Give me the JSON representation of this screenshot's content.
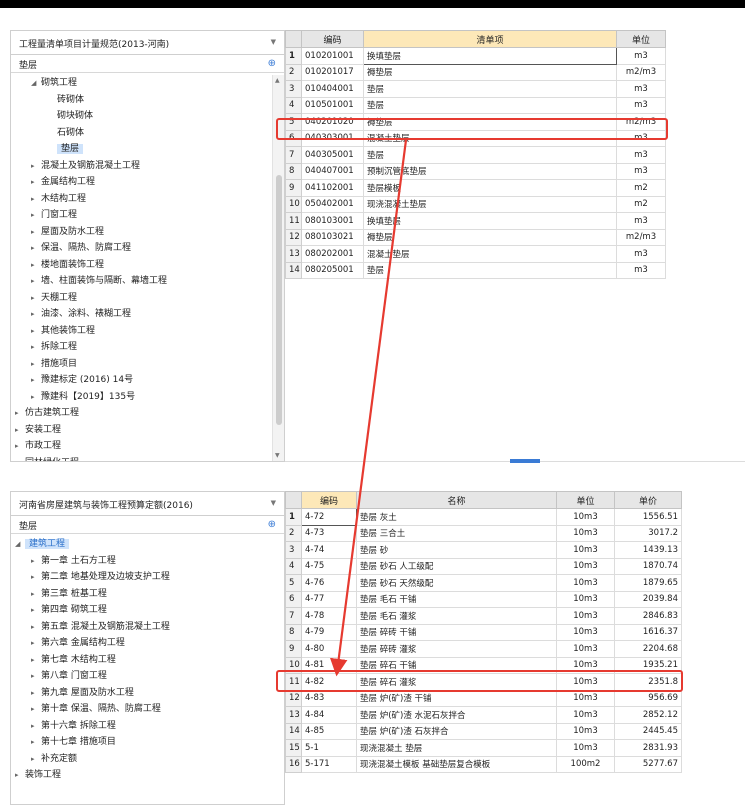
{
  "top_panel": {
    "combo_label": "工程量清单项目计量规范(2013-河南)",
    "filter_text": "垫层",
    "tree": [
      {
        "label": "砌筑工程",
        "level": 2,
        "toggle": "▲"
      },
      {
        "label": "砖砌体",
        "level": 4,
        "toggle": ""
      },
      {
        "label": "砌块砌体",
        "level": 4,
        "toggle": ""
      },
      {
        "label": "石砌体",
        "level": 4,
        "toggle": ""
      },
      {
        "label": "垫层",
        "level": 4,
        "toggle": "",
        "selected": true
      },
      {
        "label": "混凝土及钢筋混凝土工程",
        "level": 2,
        "toggle": "▸"
      },
      {
        "label": "金属结构工程",
        "level": 2,
        "toggle": "▸"
      },
      {
        "label": "木结构工程",
        "level": 2,
        "toggle": "▸"
      },
      {
        "label": "门窗工程",
        "level": 2,
        "toggle": "▸"
      },
      {
        "label": "屋面及防水工程",
        "level": 2,
        "toggle": "▸"
      },
      {
        "label": "保温、隔热、防腐工程",
        "level": 2,
        "toggle": "▸"
      },
      {
        "label": "楼地面装饰工程",
        "level": 2,
        "toggle": "▸"
      },
      {
        "label": "墙、柱面装饰与隔断、幕墙工程",
        "level": 2,
        "toggle": "▸"
      },
      {
        "label": "天棚工程",
        "level": 2,
        "toggle": "▸"
      },
      {
        "label": "油漆、涂料、裱糊工程",
        "level": 2,
        "toggle": "▸"
      },
      {
        "label": "其他装饰工程",
        "level": 2,
        "toggle": "▸"
      },
      {
        "label": "拆除工程",
        "level": 2,
        "toggle": "▸"
      },
      {
        "label": "措施项目",
        "level": 2,
        "toggle": "▸"
      },
      {
        "label": "豫建标定 (2016) 14号",
        "level": 2,
        "toggle": "▸"
      },
      {
        "label": "豫建科【2019】135号",
        "level": 2,
        "toggle": "▸"
      },
      {
        "label": "仿古建筑工程",
        "level": 0,
        "toggle": "▸"
      },
      {
        "label": "安装工程",
        "level": 0,
        "toggle": "▸"
      },
      {
        "label": "市政工程",
        "level": 0,
        "toggle": "▸"
      },
      {
        "label": "园林绿化工程",
        "level": 0,
        "toggle": "▸"
      }
    ],
    "grid": {
      "headers": [
        "",
        "编码",
        "清单项",
        "单位"
      ],
      "rows": [
        {
          "n": "1",
          "code": "010201001",
          "name": "换填垫层",
          "unit": "m3"
        },
        {
          "n": "2",
          "code": "010201017",
          "name": "褥垫层",
          "unit": "m2/m3"
        },
        {
          "n": "3",
          "code": "010404001",
          "name": "垫层",
          "unit": "m3"
        },
        {
          "n": "4",
          "code": "010501001",
          "name": "垫层",
          "unit": "m3"
        },
        {
          "n": "5",
          "code": "040201020",
          "name": "褥垫层",
          "unit": "m2/m3"
        },
        {
          "n": "6",
          "code": "040303001",
          "name": "混凝土垫层",
          "unit": "m3"
        },
        {
          "n": "7",
          "code": "040305001",
          "name": "垫层",
          "unit": "m3"
        },
        {
          "n": "8",
          "code": "040407001",
          "name": "预制沉管底垫层",
          "unit": "m3"
        },
        {
          "n": "9",
          "code": "041102001",
          "name": "垫层模板",
          "unit": "m2"
        },
        {
          "n": "10",
          "code": "050402001",
          "name": "现浇混凝土垫层",
          "unit": "m2"
        },
        {
          "n": "11",
          "code": "080103001",
          "name": "换填垫层",
          "unit": "m3"
        },
        {
          "n": "12",
          "code": "080103021",
          "name": "褥垫层",
          "unit": "m2/m3"
        },
        {
          "n": "13",
          "code": "080202001",
          "name": "混凝土垫层",
          "unit": "m3"
        },
        {
          "n": "14",
          "code": "080205001",
          "name": "垫层",
          "unit": "m3"
        }
      ]
    }
  },
  "bottom_panel": {
    "combo_label": "河南省房屋建筑与装饰工程预算定额(2016)",
    "filter_text": "垫层",
    "tree": [
      {
        "label": "建筑工程",
        "level": 0,
        "toggle": "▲",
        "blue": true,
        "selected": true
      },
      {
        "label": "第一章 土石方工程",
        "level": 2,
        "toggle": "▸"
      },
      {
        "label": "第二章 地基处理及边坡支护工程",
        "level": 2,
        "toggle": "▸"
      },
      {
        "label": "第三章 桩基工程",
        "level": 2,
        "toggle": "▸"
      },
      {
        "label": "第四章 砌筑工程",
        "level": 2,
        "toggle": "▸"
      },
      {
        "label": "第五章 混凝土及钢筋混凝土工程",
        "level": 2,
        "toggle": "▸"
      },
      {
        "label": "第六章 金属结构工程",
        "level": 2,
        "toggle": "▸"
      },
      {
        "label": "第七章 木结构工程",
        "level": 2,
        "toggle": "▸"
      },
      {
        "label": "第八章 门窗工程",
        "level": 2,
        "toggle": "▸"
      },
      {
        "label": "第九章 屋面及防水工程",
        "level": 2,
        "toggle": "▸"
      },
      {
        "label": "第十章 保温、隔热、防腐工程",
        "level": 2,
        "toggle": "▸"
      },
      {
        "label": "第十六章 拆除工程",
        "level": 2,
        "toggle": "▸"
      },
      {
        "label": "第十七章 措施项目",
        "level": 2,
        "toggle": "▸"
      },
      {
        "label": "补充定额",
        "level": 2,
        "toggle": "▸"
      },
      {
        "label": "装饰工程",
        "level": 0,
        "toggle": "▸"
      }
    ],
    "grid": {
      "headers": [
        "",
        "编码",
        "名称",
        "单位",
        "单价"
      ],
      "rows": [
        {
          "n": "1",
          "code": "4-72",
          "name": "垫层 灰土",
          "unit": "10m3",
          "price": "1556.51"
        },
        {
          "n": "2",
          "code": "4-73",
          "name": "垫层 三合土",
          "unit": "10m3",
          "price": "3017.2"
        },
        {
          "n": "3",
          "code": "4-74",
          "name": "垫层 砂",
          "unit": "10m3",
          "price": "1439.13"
        },
        {
          "n": "4",
          "code": "4-75",
          "name": "垫层 砂石 人工级配",
          "unit": "10m3",
          "price": "1870.74"
        },
        {
          "n": "5",
          "code": "4-76",
          "name": "垫层 砂石 天然级配",
          "unit": "10m3",
          "price": "1879.65"
        },
        {
          "n": "6",
          "code": "4-77",
          "name": "垫层 毛石 干铺",
          "unit": "10m3",
          "price": "2039.84"
        },
        {
          "n": "7",
          "code": "4-78",
          "name": "垫层 毛石 灌浆",
          "unit": "10m3",
          "price": "2846.83"
        },
        {
          "n": "8",
          "code": "4-79",
          "name": "垫层 碎砖 干铺",
          "unit": "10m3",
          "price": "1616.37"
        },
        {
          "n": "9",
          "code": "4-80",
          "name": "垫层 碎砖 灌浆",
          "unit": "10m3",
          "price": "2204.68"
        },
        {
          "n": "10",
          "code": "4-81",
          "name": "垫层 碎石 干铺",
          "unit": "10m3",
          "price": "1935.21"
        },
        {
          "n": "11",
          "code": "4-82",
          "name": "垫层 碎石 灌浆",
          "unit": "10m3",
          "price": "2351.8"
        },
        {
          "n": "12",
          "code": "4-83",
          "name": "垫层 炉(矿)渣 干铺",
          "unit": "10m3",
          "price": "956.69"
        },
        {
          "n": "13",
          "code": "4-84",
          "name": "垫层 炉(矿)渣 水泥石灰拌合",
          "unit": "10m3",
          "price": "2852.12"
        },
        {
          "n": "14",
          "code": "4-85",
          "name": "垫层 炉(矿)渣 石灰拌合",
          "unit": "10m3",
          "price": "2445.45"
        },
        {
          "n": "15",
          "code": "5-1",
          "name": "现浇混凝土 垫层",
          "unit": "10m3",
          "price": "2831.93"
        },
        {
          "n": "16",
          "code": "5-171",
          "name": "现浇混凝土模板 基础垫层复合模板",
          "unit": "100m2",
          "price": "5277.67"
        }
      ]
    }
  },
  "colors": {
    "highlight": "#e63a30",
    "selected_node": "#cfe3fb",
    "header_accent": "#fde8b8"
  }
}
